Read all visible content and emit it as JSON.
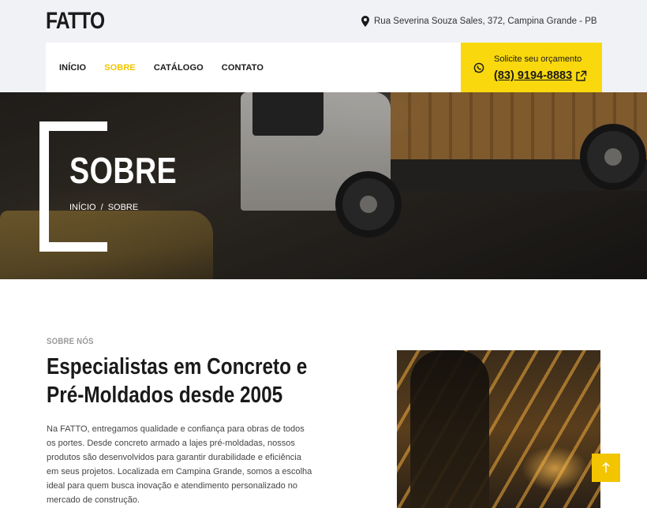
{
  "header": {
    "logo": "FATTO",
    "address": "Rua Severina Souza Sales, 372, Campina Grande - PB",
    "address_icon": "map-pin-icon"
  },
  "nav": {
    "items": [
      {
        "label": "INÍCIO",
        "active": false
      },
      {
        "label": "SOBRE",
        "active": true
      },
      {
        "label": "CATÁLOGO",
        "active": false
      },
      {
        "label": "CONTATO",
        "active": false
      }
    ]
  },
  "cta": {
    "label": "Solicite seu orçamento",
    "phone": "(83) 9194-8883",
    "icon": "whatsapp-icon",
    "external_icon": "external-link-icon",
    "color": "#f9d80d"
  },
  "hero": {
    "title": "SOBRE",
    "breadcrumb": [
      "INÍCIO",
      "/",
      "SOBRE"
    ]
  },
  "about": {
    "eyebrow": "SOBRE NÓS",
    "title": "Especialistas em Concreto e Pré-Moldados desde 2005",
    "text": "Na FATTO, entregamos qualidade e confiança para obras de todos os portes. Desde concreto armado a lajes pré-moldadas, nossos produtos são desenvolvidos para garantir durabilidade e eficiência em seus projetos. Localizada em Campina Grande, somos a escolha ideal para quem busca inovação e atendimento personalizado no mercado de construção."
  },
  "scroll_top": {
    "icon": "arrow-up-icon",
    "color": "#f2c500"
  },
  "colors": {
    "accent": "#f2c500",
    "background": "#f1f2f6"
  }
}
